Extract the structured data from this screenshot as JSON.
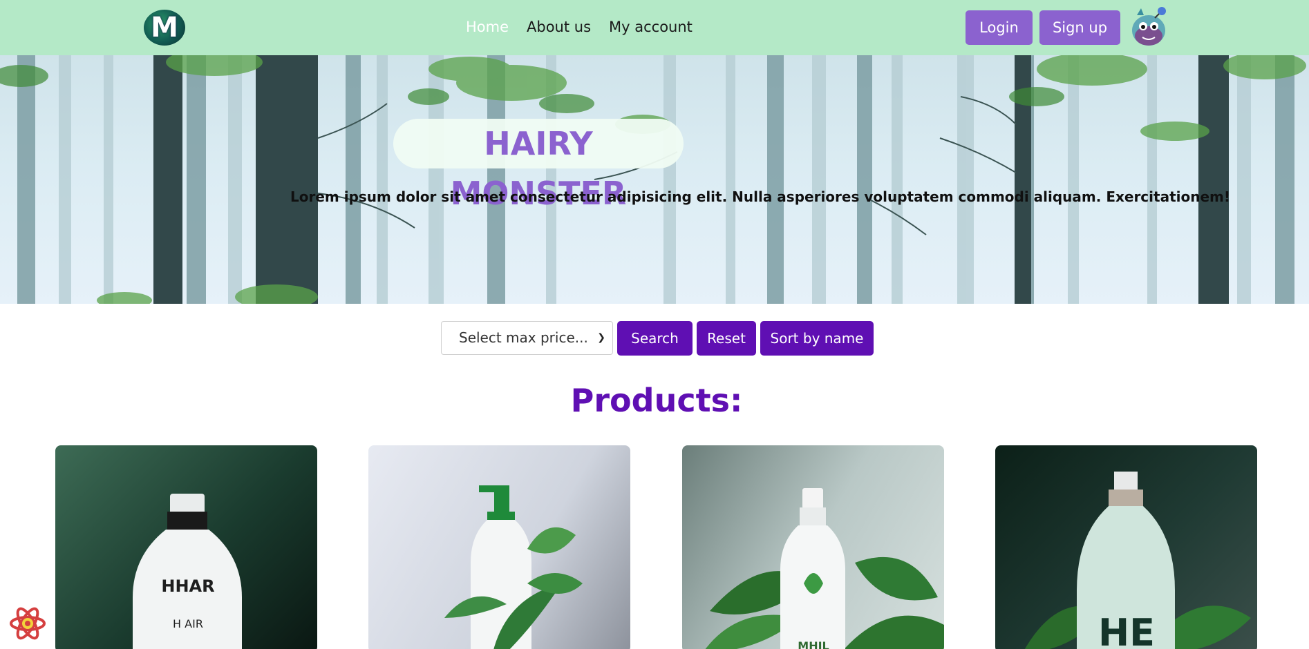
{
  "nav": {
    "logo_letter": "M",
    "links": [
      "Home",
      "About us",
      "My account"
    ],
    "login_label": "Login",
    "signup_label": "Sign up"
  },
  "hero": {
    "title": "HAIRY MONSTER",
    "subtitle": "Lorem ipsum dolor sit amet consectetur adipisicing elit. Nulla asperiores voluptatem commodi aliquam. Exercitationem!"
  },
  "filter": {
    "select_value": "Select max price...",
    "search_label": "Search",
    "reset_label": "Reset",
    "sort_label": "Sort by name"
  },
  "products": {
    "heading": "Products:",
    "items": [
      {
        "bottle_text_top": "HHAR",
        "bottle_text_bottom": "H AIR"
      },
      {},
      {
        "bottle_text_top": "MHIL"
      },
      {
        "bottle_text_top": "HE"
      }
    ]
  },
  "colors": {
    "nav_bg": "#b4e9c7",
    "accent_purple": "#8b62cf",
    "button_purple": "#5f0fb3"
  }
}
